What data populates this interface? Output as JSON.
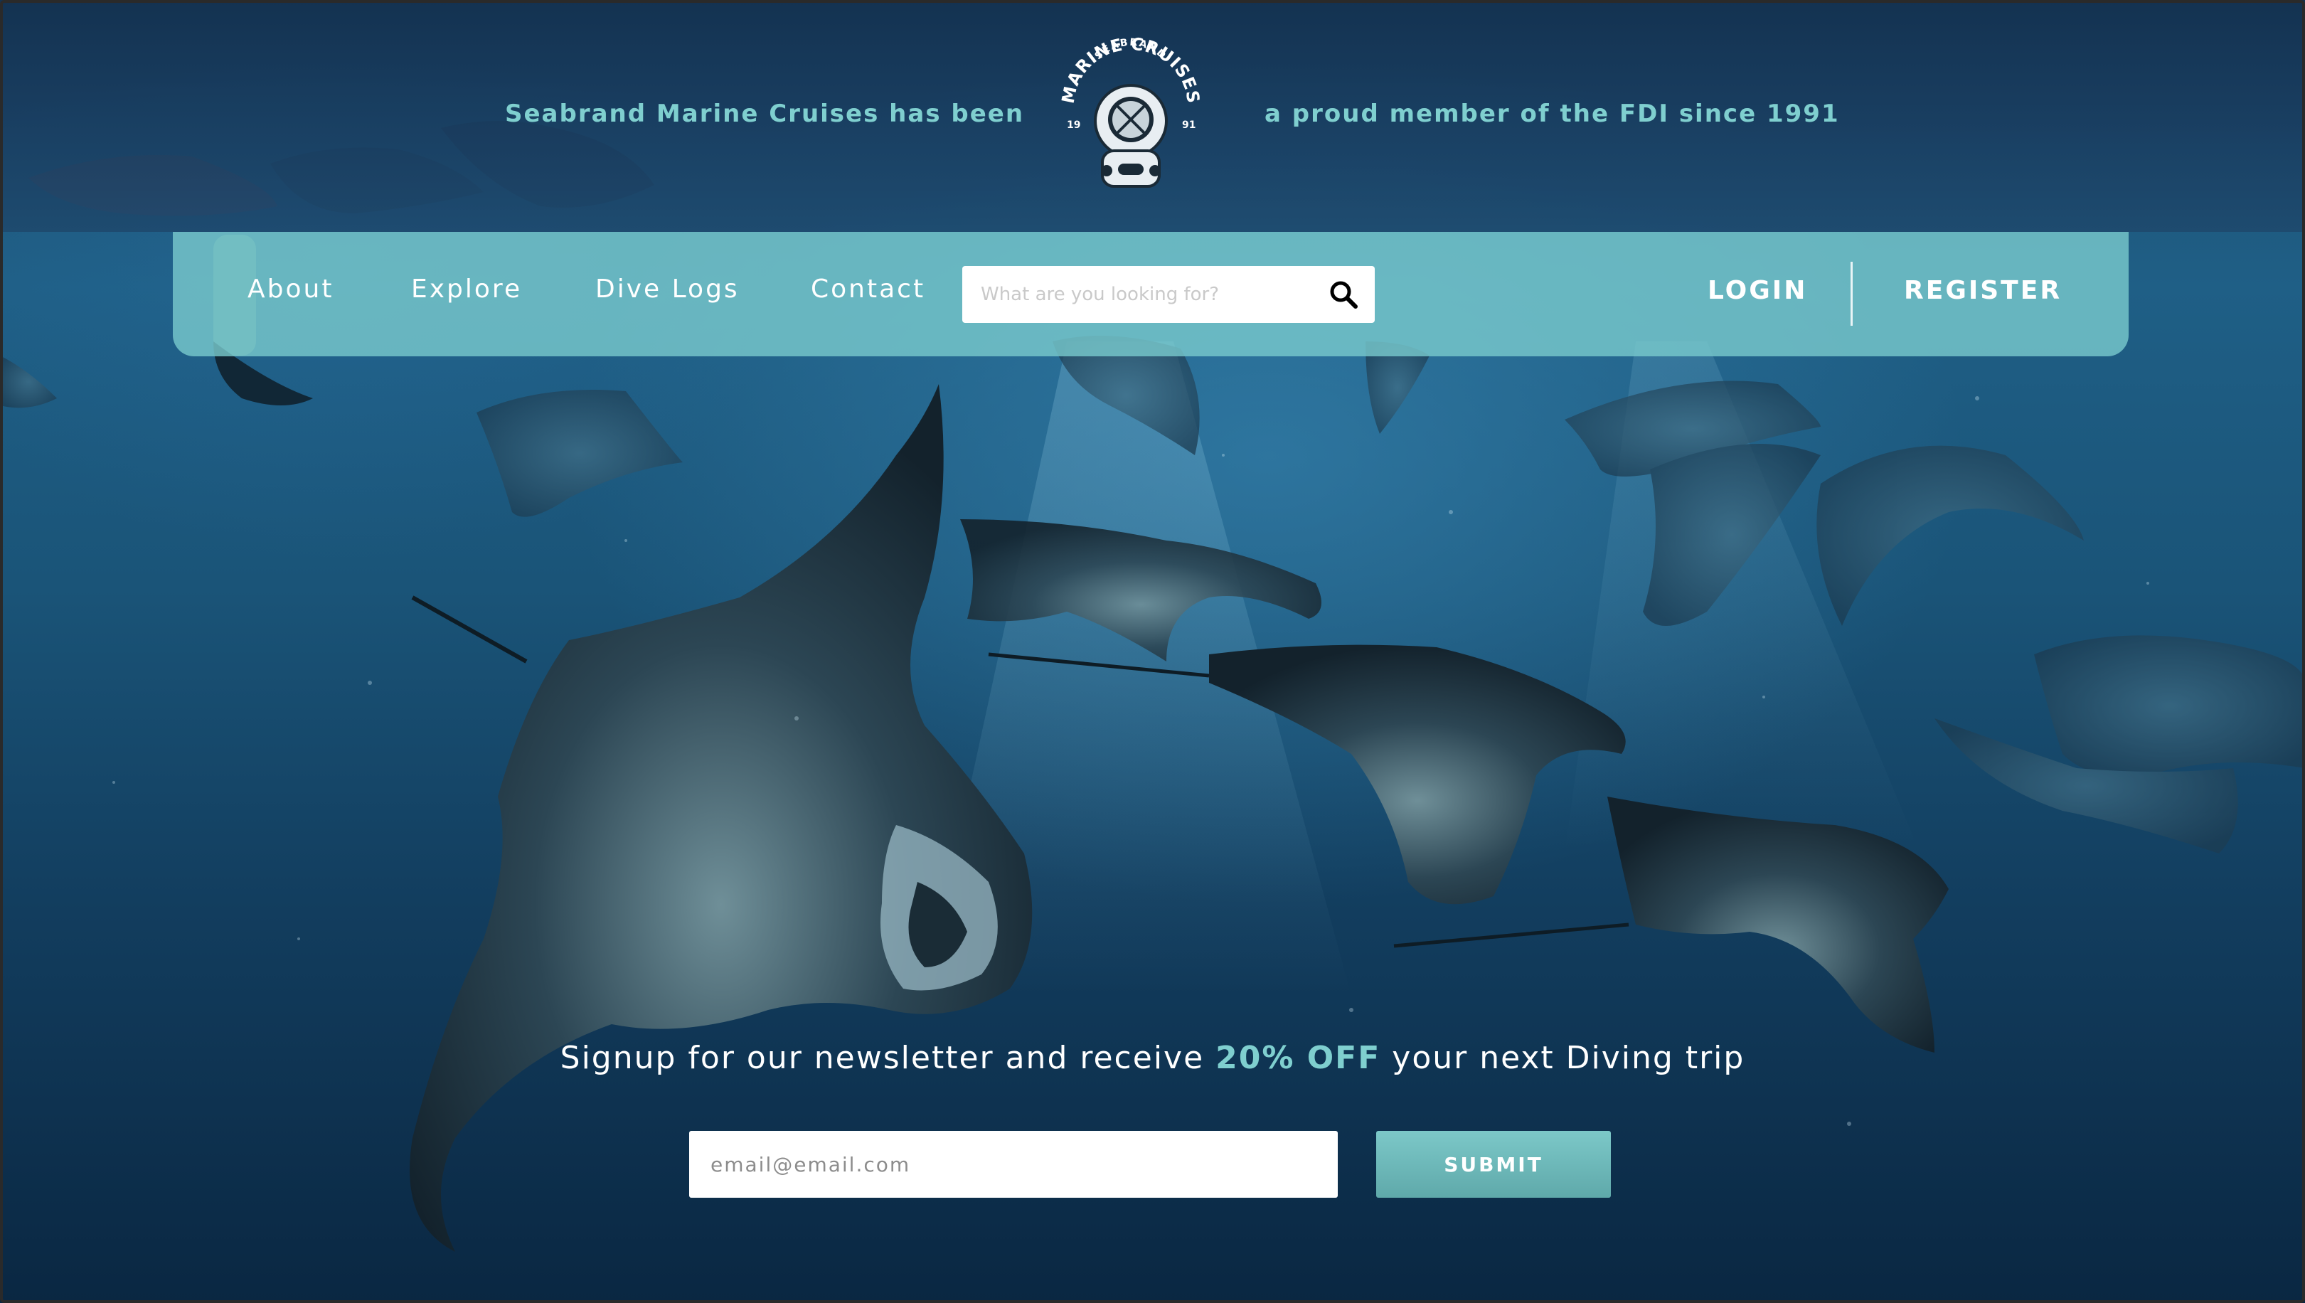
{
  "header": {
    "tagline_left": "Seabrand Marine Cruises has been",
    "tagline_right": "a proud member of the FDI since 1991",
    "logo": {
      "icon": "diving-helmet-icon",
      "top_text": "SEABRAND",
      "arc_text": "MARINE CRUISES",
      "year_left": "19",
      "year_right": "91"
    }
  },
  "nav": {
    "items": [
      {
        "label": "About"
      },
      {
        "label": "Explore"
      },
      {
        "label": "Dive Logs"
      },
      {
        "label": "Contact"
      }
    ],
    "search": {
      "placeholder": "What are you looking for?",
      "icon": "search-icon"
    },
    "login_label": "LOGIN",
    "register_label": "REGISTER"
  },
  "newsletter": {
    "text_before": "Signup for our newsletter and receive ",
    "highlight": "20% OFF",
    "text_after": " your next Diving trip",
    "email_placeholder": "email@email.com",
    "submit_label": "SUBMIT"
  },
  "colors": {
    "accent": "#7fcfcf",
    "navbar": "#78c8cc",
    "deep_water": "#0a2742"
  }
}
